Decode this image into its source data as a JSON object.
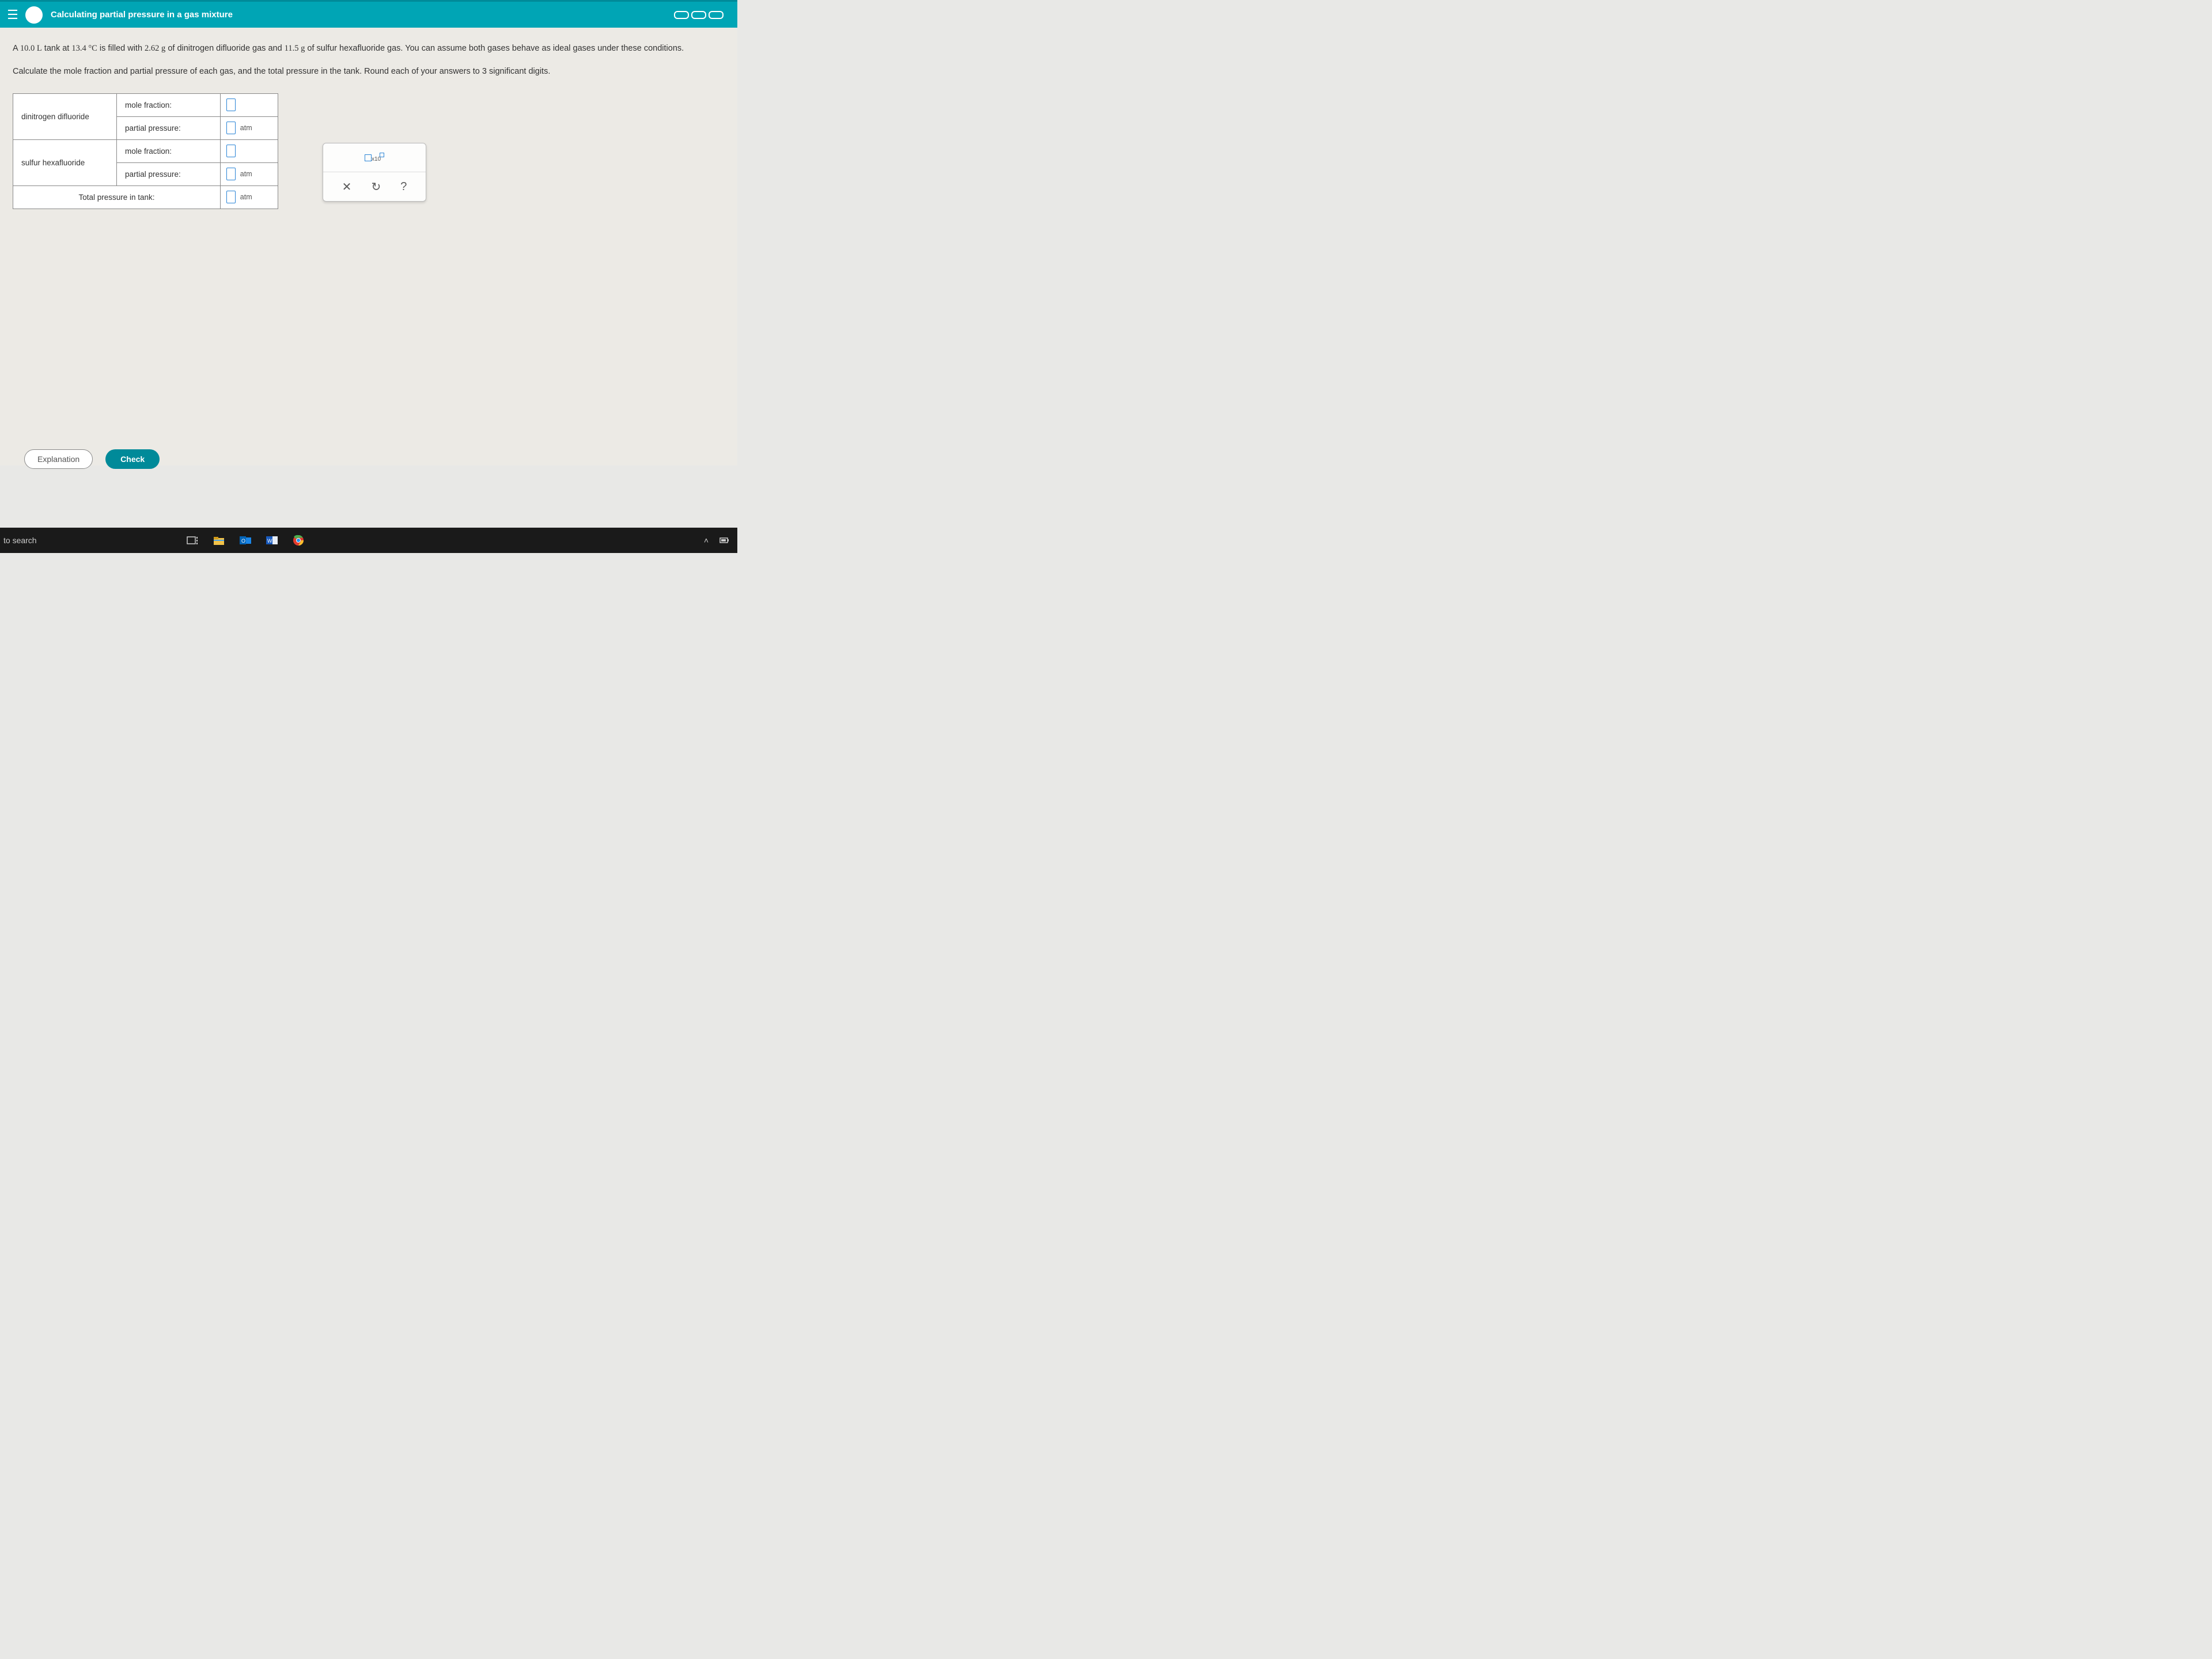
{
  "topbar": {
    "title": "Calculating partial pressure in a gas mixture"
  },
  "problem": {
    "line1a": "A ",
    "volume": "10.0 L",
    "line1b": " tank at ",
    "temp": "13.4 °C",
    "line1c": " is filled with ",
    "mass1": "2.62 g",
    "line1d": " of dinitrogen difluoride gas and ",
    "mass2": "11.5 g",
    "line1e": " of sulfur hexafluoride gas. You can assume both gases behave as ideal gases under these conditions.",
    "line2": "Calculate the mole fraction and partial pressure of each gas, and the total pressure in the tank. Round each of your answers to 3 significant digits."
  },
  "table": {
    "gas1": "dinitrogen difluoride",
    "gas2": "sulfur hexafluoride",
    "label_mf": "mole fraction:",
    "label_pp": "partial pressure:",
    "label_total": "Total pressure in tank:",
    "unit": "atm"
  },
  "toolpanel": {
    "sci_label": "x10",
    "close": "✕",
    "reset": "↻",
    "help": "?"
  },
  "footer": {
    "explanation": "Explanation",
    "check": "Check"
  },
  "taskbar": {
    "search": "to search",
    "caret": "˄"
  }
}
